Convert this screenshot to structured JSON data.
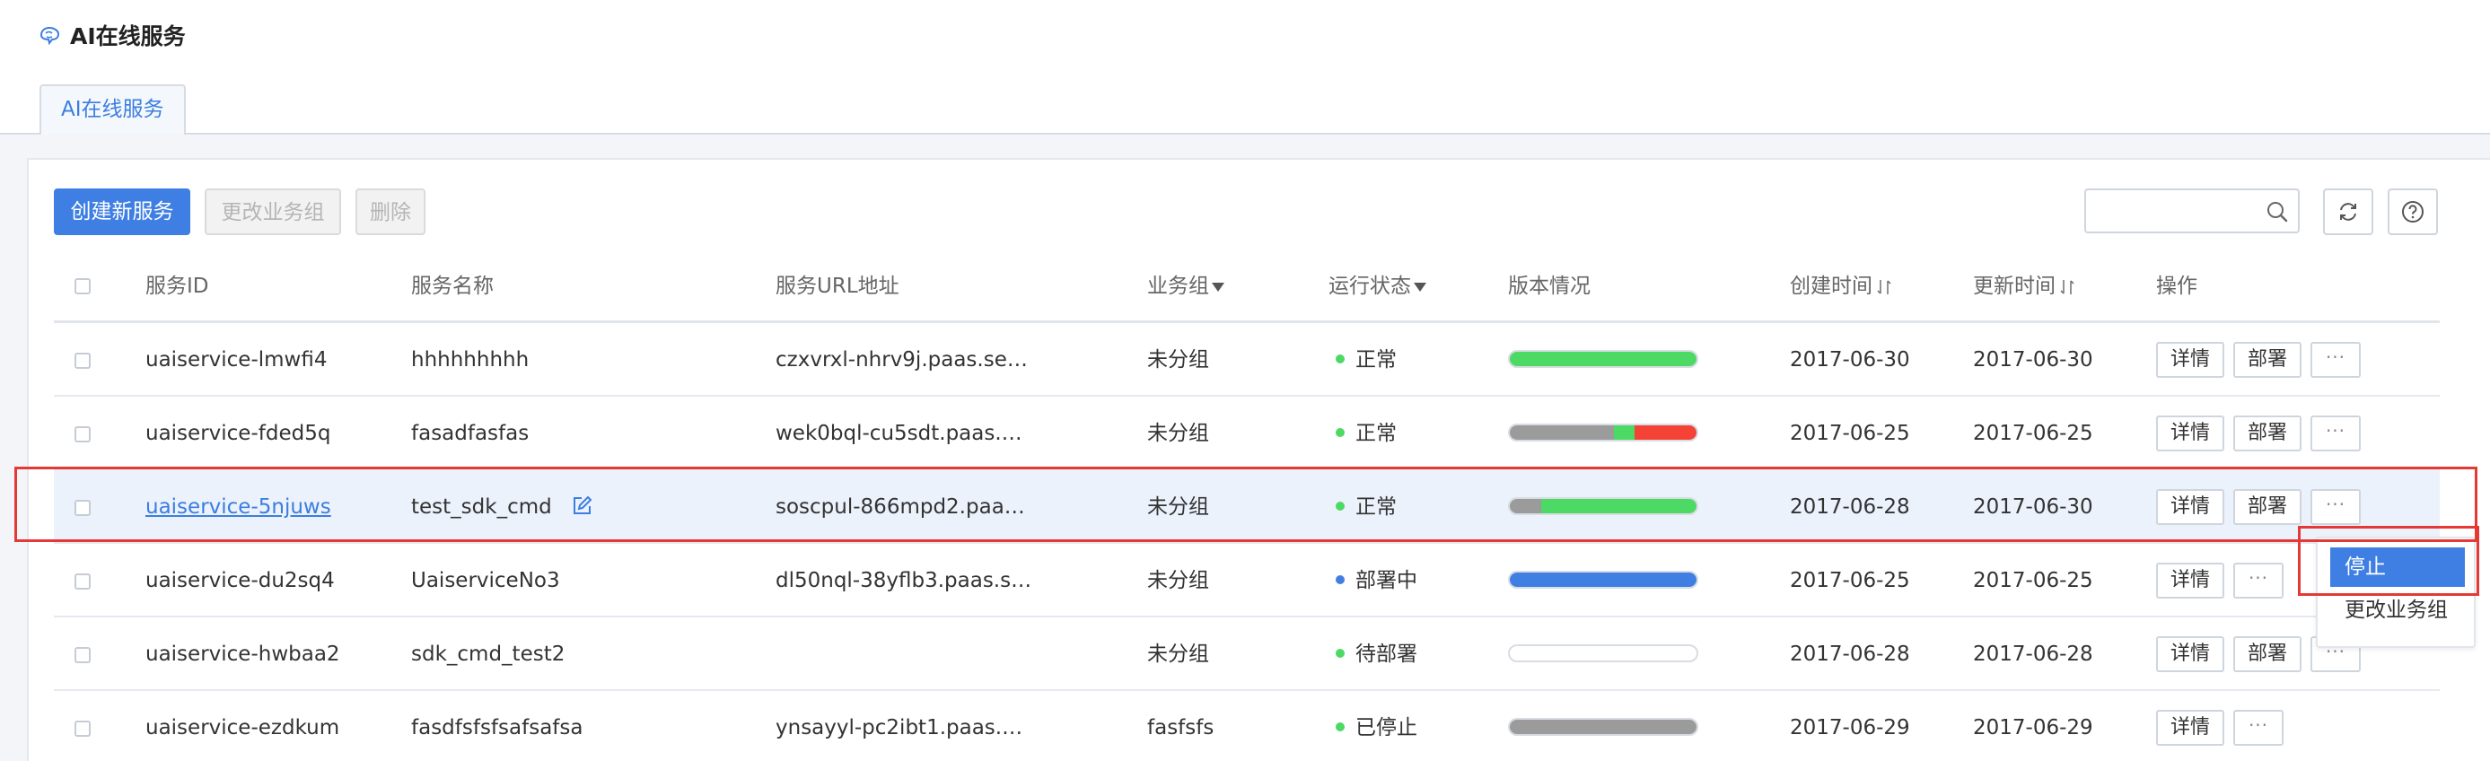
{
  "page": {
    "title": "AI在线服务"
  },
  "tabs": [
    {
      "label": "AI在线服务",
      "active": true
    }
  ],
  "toolbar": {
    "create": "创建新服务",
    "change_group": "更改业务组",
    "delete": "删除",
    "search_placeholder": ""
  },
  "icons": {
    "logo": "brain-icon",
    "search": "search-icon",
    "refresh": "refresh-icon",
    "help": "help-icon",
    "edit": "edit-icon",
    "filter": "filter-icon",
    "sort": "sort-icon"
  },
  "table": {
    "headers": {
      "id": "服务ID",
      "name": "服务名称",
      "url": "服务URL地址",
      "group": "业务组",
      "status": "运行状态",
      "version": "版本情况",
      "created": "创建时间",
      "updated": "更新时间",
      "actions": "操作"
    },
    "rows": [
      {
        "id": "uaiservice-lmwfi4",
        "name": "hhhhhhhhh",
        "url": "czxvrxl-nhrv9j.paas.se…",
        "group": "未分组",
        "status": "正常",
        "status_color": "#4cd964",
        "version": [
          {
            "color": "#4cd964",
            "fraction": 1.0
          }
        ],
        "created": "2017-06-30",
        "updated": "2017-06-30",
        "actions": [
          "详情",
          "部署",
          "···"
        ]
      },
      {
        "id": "uaiservice-fded5q",
        "name": "fasadfasfas",
        "url": "wek0bql-cu5sdt.paas.…",
        "group": "未分组",
        "status": "正常",
        "status_color": "#4cd964",
        "version": [
          {
            "color": "#9b9b9b",
            "fraction": 0.56
          },
          {
            "color": "#4cd964",
            "fraction": 0.11
          },
          {
            "color": "#f44336",
            "fraction": 0.33
          }
        ],
        "created": "2017-06-25",
        "updated": "2017-06-25",
        "actions": [
          "详情",
          "部署",
          "···"
        ]
      },
      {
        "id": "uaiservice-5njuws",
        "name": "test_sdk_cmd",
        "url": "soscpul-866mpd2.paa…",
        "group": "未分组",
        "status": "正常",
        "status_color": "#4cd964",
        "version": [
          {
            "color": "#9b9b9b",
            "fraction": 0.17
          },
          {
            "color": "#4cd964",
            "fraction": 0.83
          }
        ],
        "created": "2017-06-28",
        "updated": "2017-06-30",
        "actions": [
          "详情",
          "部署",
          "···"
        ]
      },
      {
        "id": "uaiservice-du2sq4",
        "name": "UaiserviceNo3",
        "url": "dl50nql-38yflb3.paas.s…",
        "group": "未分组",
        "status": "部署中",
        "status_color": "#3f7fe3",
        "version": [
          {
            "color": "#3f7fe3",
            "fraction": 1.0
          }
        ],
        "created": "2017-06-25",
        "updated": "2017-06-25",
        "actions": [
          "详情",
          "···"
        ]
      },
      {
        "id": "uaiservice-hwbaa2",
        "name": "sdk_cmd_test2",
        "url": "",
        "group": "未分组",
        "status": "待部署",
        "status_color": "#4cd964",
        "version": [],
        "created": "2017-06-28",
        "updated": "2017-06-28",
        "actions": [
          "详情",
          "部署",
          "···"
        ]
      },
      {
        "id": "uaiservice-ezdkum",
        "name": "fasdfsfsfsafsafsa",
        "url": "ynsayyl-pc2ibt1.paas.…",
        "group": "fasfsfs",
        "status": "已停止",
        "status_color": "#4cd964",
        "version": [
          {
            "color": "#9b9b9b",
            "fraction": 1.0
          }
        ],
        "created": "2017-06-29",
        "updated": "2017-06-29",
        "actions": [
          "详情",
          "···"
        ]
      }
    ]
  },
  "dropdown": {
    "items": [
      "停止",
      "更改业务组"
    ],
    "active_index": 0
  },
  "colors": {
    "primary": "#3f7fe3",
    "annotation": "#e53935",
    "success": "#4cd964",
    "error": "#f44336",
    "neutral": "#9b9b9b"
  }
}
